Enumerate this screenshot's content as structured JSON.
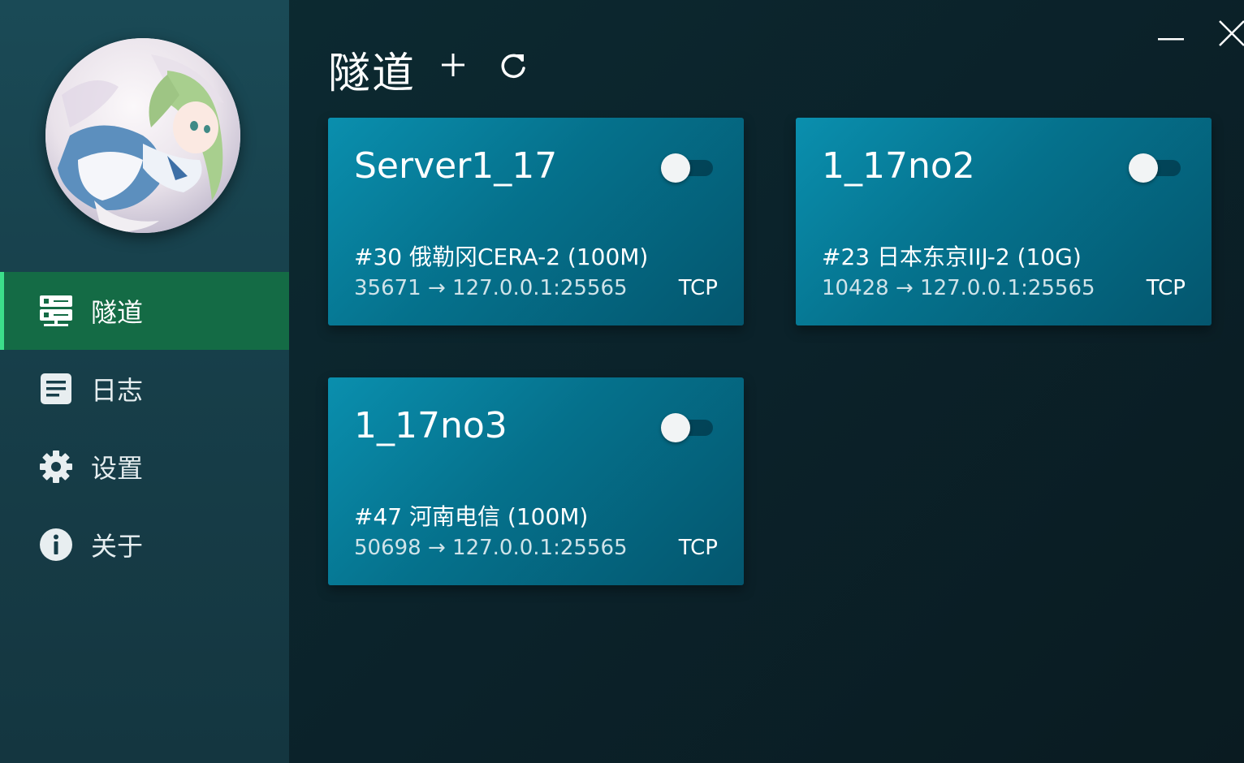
{
  "sidebar": {
    "avatar_icon": "avatar-anime-girl",
    "items": [
      {
        "label": "隧道",
        "icon": "server-icon",
        "active": true
      },
      {
        "label": "日志",
        "icon": "log-icon",
        "active": false
      },
      {
        "label": "设置",
        "icon": "gear-icon",
        "active": false
      },
      {
        "label": "关于",
        "icon": "info-icon",
        "active": false
      }
    ]
  },
  "header": {
    "title": "隧道",
    "add_icon": "plus-icon",
    "refresh_icon": "refresh-icon"
  },
  "window": {
    "minimize_icon": "minimize-icon",
    "close_icon": "close-icon"
  },
  "tunnels": [
    {
      "name": "Server1_17",
      "node": "#30 俄勒冈CERA-2 (100M)",
      "mapping": "35671 → 127.0.0.1:25565",
      "protocol": "TCP",
      "enabled": false
    },
    {
      "name": "1_17no2",
      "node": "#23 日本东京IIJ-2 (10G)",
      "mapping": "10428 → 127.0.0.1:25565",
      "protocol": "TCP",
      "enabled": false
    },
    {
      "name": "1_17no3",
      "node": "#47 河南电信 (100M)",
      "mapping": "50698 → 127.0.0.1:25565",
      "protocol": "TCP",
      "enabled": false
    }
  ],
  "colors": {
    "accent": "#146b45",
    "accent_bar": "#3ce08a",
    "card": "#05718c",
    "sidebar": "#173e49",
    "background": "#0b222a"
  }
}
